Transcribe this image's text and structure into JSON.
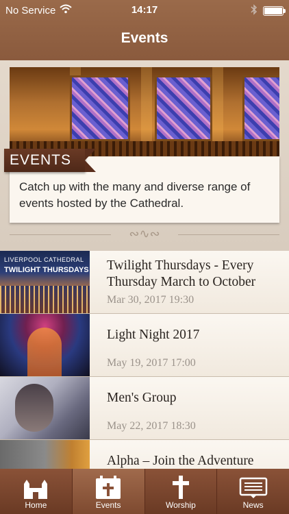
{
  "status_bar": {
    "carrier": "No Service",
    "time": "14:17"
  },
  "nav": {
    "title": "Events"
  },
  "header": {
    "ribbon_label": "EVENTS",
    "description": "Catch up with the many and diverse range of events hosted by the Cathedral."
  },
  "events": [
    {
      "thumb_caption_top": "LIVERPOOL CATHEDRAL",
      "thumb_caption_main": "TWILIGHT THURSDAYS",
      "title": "Twilight Thursdays - Every Thursday March to October",
      "date": "Mar 30, 2017 19:30"
    },
    {
      "title": "Light Night 2017",
      "date": "May 19, 2017 17:00"
    },
    {
      "title": "Men's Group",
      "date": "May 22, 2017 18:30"
    },
    {
      "title": "Alpha – Join the Adventure",
      "date": ""
    }
  ],
  "tabs": [
    {
      "label": "Home",
      "icon": "cathedral-icon"
    },
    {
      "label": "Events",
      "icon": "calendar-cross-icon",
      "active": true
    },
    {
      "label": "Worship",
      "icon": "cross-icon"
    },
    {
      "label": "News",
      "icon": "newspaper-icon"
    }
  ],
  "colors": {
    "nav_brown": "#8a5a3d",
    "tab_brown": "#6a3a24",
    "ribbon_brown": "#4e2818",
    "date_gray": "#9a928a"
  }
}
